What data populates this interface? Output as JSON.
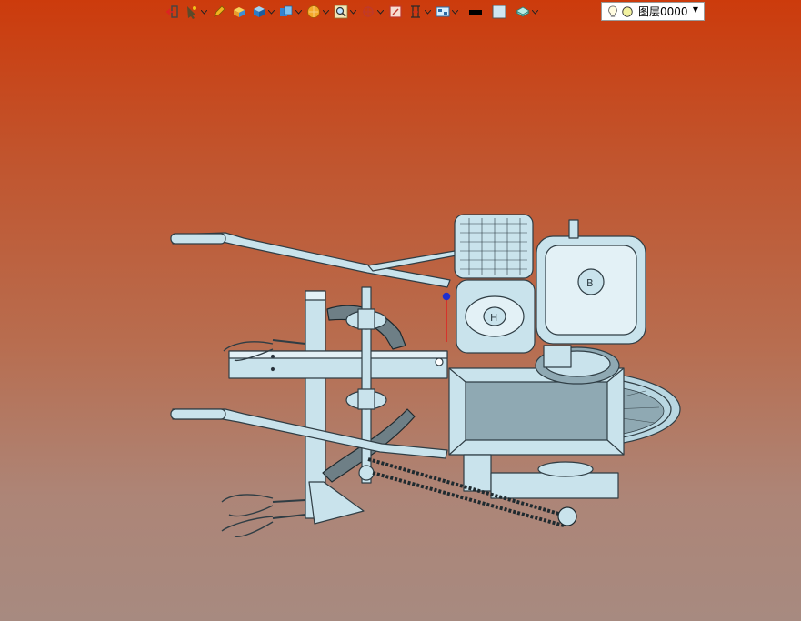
{
  "toolbar": {
    "icons": [
      {
        "name": "exit-icon",
        "dropdown": false
      },
      {
        "name": "pointer-wand-icon",
        "dropdown": true
      },
      {
        "name": "pencil-icon",
        "dropdown": false
      },
      {
        "name": "box-solid-icon",
        "dropdown": false
      },
      {
        "name": "cube-view-icon",
        "dropdown": true
      },
      {
        "name": "multi-view-icon",
        "dropdown": true
      },
      {
        "name": "render-sphere-icon",
        "dropdown": true
      },
      {
        "name": "zoom-fit-icon",
        "dropdown": true
      },
      {
        "name": "rotate-axis-icon",
        "dropdown": true
      },
      {
        "name": "section-box-icon",
        "dropdown": false
      },
      {
        "name": "measure-icon",
        "dropdown": true
      },
      {
        "name": "display-settings-icon",
        "dropdown": true
      },
      {
        "name": "line-color-swatch",
        "dropdown": false
      },
      {
        "name": "fill-color-swatch",
        "dropdown": false
      },
      {
        "name": "layer-tools-icon",
        "dropdown": true
      }
    ]
  },
  "layer": {
    "name": "图层0000",
    "bulb_icon": "lightbulb-icon",
    "color_icon": "layer-color-dot-icon"
  },
  "colors": {
    "model_fill": "#c9e3ec",
    "model_edge": "#2f3d44",
    "line_swatch": "#000000",
    "fill_swatch": "#cfe6f2",
    "layer_dot": "#f2f2a0"
  }
}
